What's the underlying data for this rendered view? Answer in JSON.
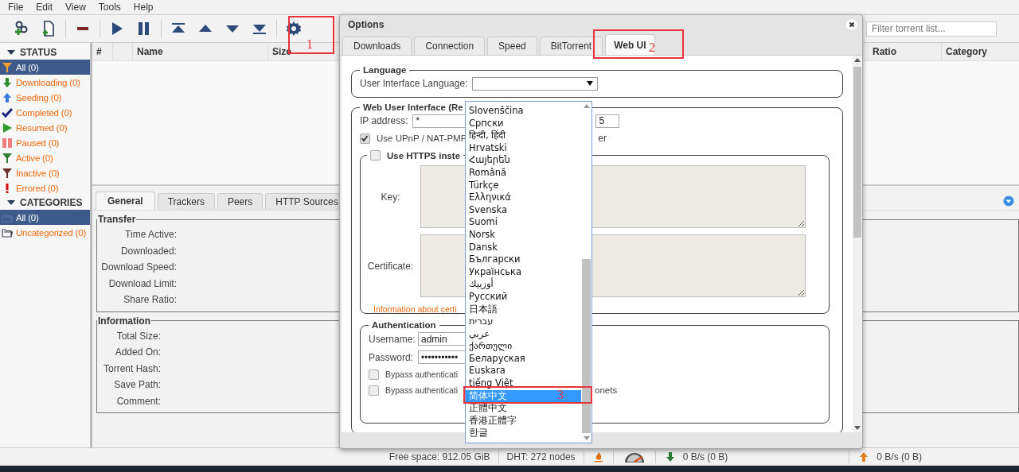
{
  "menu": [
    "File",
    "Edit",
    "View",
    "Tools",
    "Help"
  ],
  "filter": {
    "placeholder": "Filter torrent list..."
  },
  "sidebar": [
    {
      "title": "STATUS",
      "expanded": true,
      "items": [
        {
          "label": "All (0)",
          "kind": "all",
          "selected": true
        },
        {
          "label": "Downloading (0)",
          "kind": "downloading",
          "selected": false
        },
        {
          "label": "Seeding (0)",
          "kind": "seeding",
          "selected": false
        },
        {
          "label": "Completed (0)",
          "kind": "completed",
          "selected": false
        },
        {
          "label": "Resumed (0)",
          "kind": "resumed",
          "selected": false
        },
        {
          "label": "Paused (0)",
          "kind": "paused",
          "selected": false
        },
        {
          "label": "Active (0)",
          "kind": "active",
          "selected": false
        },
        {
          "label": "Inactive (0)",
          "kind": "inactive",
          "selected": false
        },
        {
          "label": "Errored (0)",
          "kind": "errored",
          "selected": false
        }
      ]
    },
    {
      "title": "CATEGORIES",
      "expanded": true,
      "items": [
        {
          "label": "All (0)",
          "kind": "folder",
          "selected": true
        },
        {
          "label": "Uncategorized (0)",
          "kind": "folder",
          "selected": false
        }
      ]
    }
  ],
  "torrent_table": {
    "columns": [
      "#",
      "Name",
      "Size",
      "Ratio",
      "Category"
    ]
  },
  "details": {
    "tabs": [
      {
        "label": "General",
        "selected": true
      },
      {
        "label": "Trackers",
        "selected": false
      },
      {
        "label": "Peers",
        "selected": false
      },
      {
        "label": "HTTP Sources",
        "selected": false
      }
    ],
    "groups": [
      {
        "title": "Transfer",
        "fields": [
          "Time Active:",
          "Downloaded:",
          "Download Speed:",
          "Download Limit:",
          "Share Ratio:"
        ]
      },
      {
        "title": "Information",
        "fields": [
          "Total Size:",
          "Added On:",
          "Torrent Hash:",
          "Save Path:",
          "Comment:"
        ]
      }
    ]
  },
  "dialog": {
    "title": "Options",
    "tabs": [
      {
        "label": "Downloads",
        "selected": false
      },
      {
        "label": "Connection",
        "selected": false
      },
      {
        "label": "Speed",
        "selected": false
      },
      {
        "label": "BitTorrent",
        "selected": false
      },
      {
        "label": "Web UI",
        "selected": true
      }
    ],
    "language": {
      "legend": "Language",
      "label": "User Interface Language:",
      "options": [
        {
          "label": "Slovenščina",
          "selected": false
        },
        {
          "label": "Српски",
          "selected": false
        },
        {
          "label": "हिन्दी, हिंदी",
          "selected": false
        },
        {
          "label": "Hrvatski",
          "selected": false
        },
        {
          "label": "Հայերեն",
          "selected": false
        },
        {
          "label": "Română",
          "selected": false
        },
        {
          "label": "Türkçe",
          "selected": false
        },
        {
          "label": "Ελληνικά",
          "selected": false
        },
        {
          "label": "Svenska",
          "selected": false
        },
        {
          "label": "Suomi",
          "selected": false
        },
        {
          "label": "Norsk",
          "selected": false
        },
        {
          "label": "Dansk",
          "selected": false
        },
        {
          "label": "Български",
          "selected": false
        },
        {
          "label": "Українська",
          "selected": false
        },
        {
          "label": "أوزبيك",
          "selected": false
        },
        {
          "label": "Русский",
          "selected": false
        },
        {
          "label": "日本語",
          "selected": false
        },
        {
          "label": "עברית",
          "selected": false
        },
        {
          "label": "عربي",
          "selected": false
        },
        {
          "label": "ქართული",
          "selected": false
        },
        {
          "label": "Беларуская",
          "selected": false
        },
        {
          "label": "Euskara",
          "selected": false
        },
        {
          "label": "tiếng Việt",
          "selected": false
        },
        {
          "label": "简体中文",
          "selected": true
        },
        {
          "label": "正體中文",
          "selected": false
        },
        {
          "label": "香港正體字",
          "selected": false
        },
        {
          "label": "한글",
          "selected": false
        }
      ]
    },
    "webui": {
      "legend": "Web User Interface (Re",
      "ip_label": "IP address:",
      "ip_value": "*",
      "port_value": "5",
      "upnp": {
        "label": "Use UPnP / NAT-PMP",
        "label_end": "er",
        "checked": true
      },
      "https": {
        "label": "Use HTTPS inste",
        "checked": false,
        "key_label": "Key:",
        "certificate_label": "Certificate:",
        "info_link": "Information about certi"
      },
      "auth": {
        "legend": "Authentication",
        "username_label": "Username:",
        "username": "admin",
        "password_label": "Password:",
        "password": "•••••••••••",
        "bypass": [
          {
            "label": "Bypass authenticati",
            "checked": false
          },
          {
            "label": "Bypass authenticati",
            "label_end": "onets",
            "checked": false
          }
        ]
      }
    }
  },
  "status_bar": {
    "free_space": "Free space: 912.05 GiB",
    "dht": "DHT: 272 nodes",
    "download": "0 B/s (0 B)",
    "upload": "0 B/s (0 B)"
  },
  "annotations": [
    "1",
    "2",
    "3"
  ]
}
